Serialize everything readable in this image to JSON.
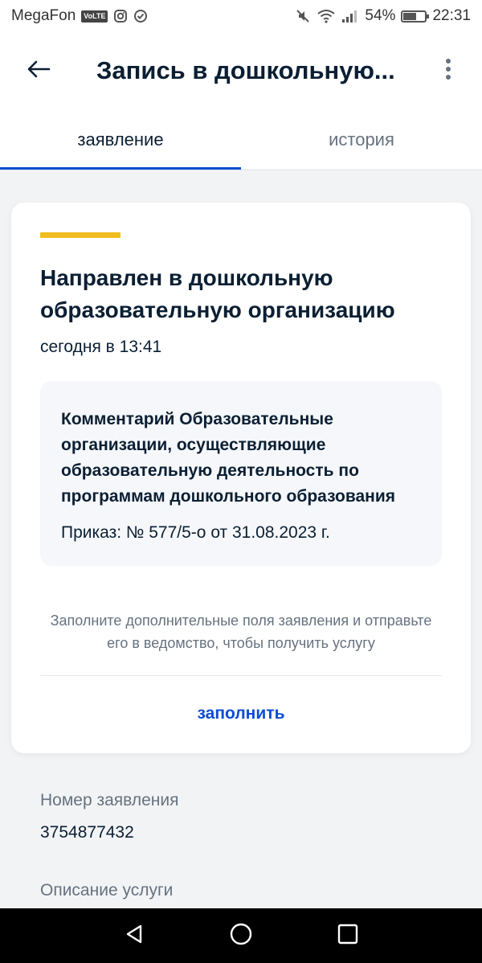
{
  "status_bar": {
    "carrier": "MegaFon",
    "volte": "VoLTE",
    "battery": "54%",
    "time": "22:31"
  },
  "header": {
    "title": "Запись в дошкольную...",
    "tabs": [
      {
        "label": "заявление",
        "active": true
      },
      {
        "label": "история",
        "active": false
      }
    ]
  },
  "card": {
    "status_title": "Направлен в дошкольную образовательную организацию",
    "status_time": "сегодня в 13:41",
    "comment_head": "Комментарий Образовательные организации, осуществляющие образовательную деятельность по программам дошкольного образования",
    "comment_body": "Приказ: № 577/5-о от 31.08.2023 г.",
    "hint": "Заполните дополнительные поля заявления и отправьте его в ведомство, чтобы получить услугу",
    "fill_button": "заполнить"
  },
  "details": {
    "number_label": "Номер заявления",
    "number_value": "3754877432",
    "service_label": "Описание услуги"
  },
  "colors": {
    "accent_blue": "#0d4cd3",
    "accent_yellow": "#f0bd21",
    "text_primary": "#0b1f33",
    "text_secondary": "#66727f"
  },
  "icons": [
    "back-arrow-icon",
    "more-vertical-icon",
    "nav-back-icon",
    "nav-home-icon",
    "nav-recents-icon"
  ]
}
